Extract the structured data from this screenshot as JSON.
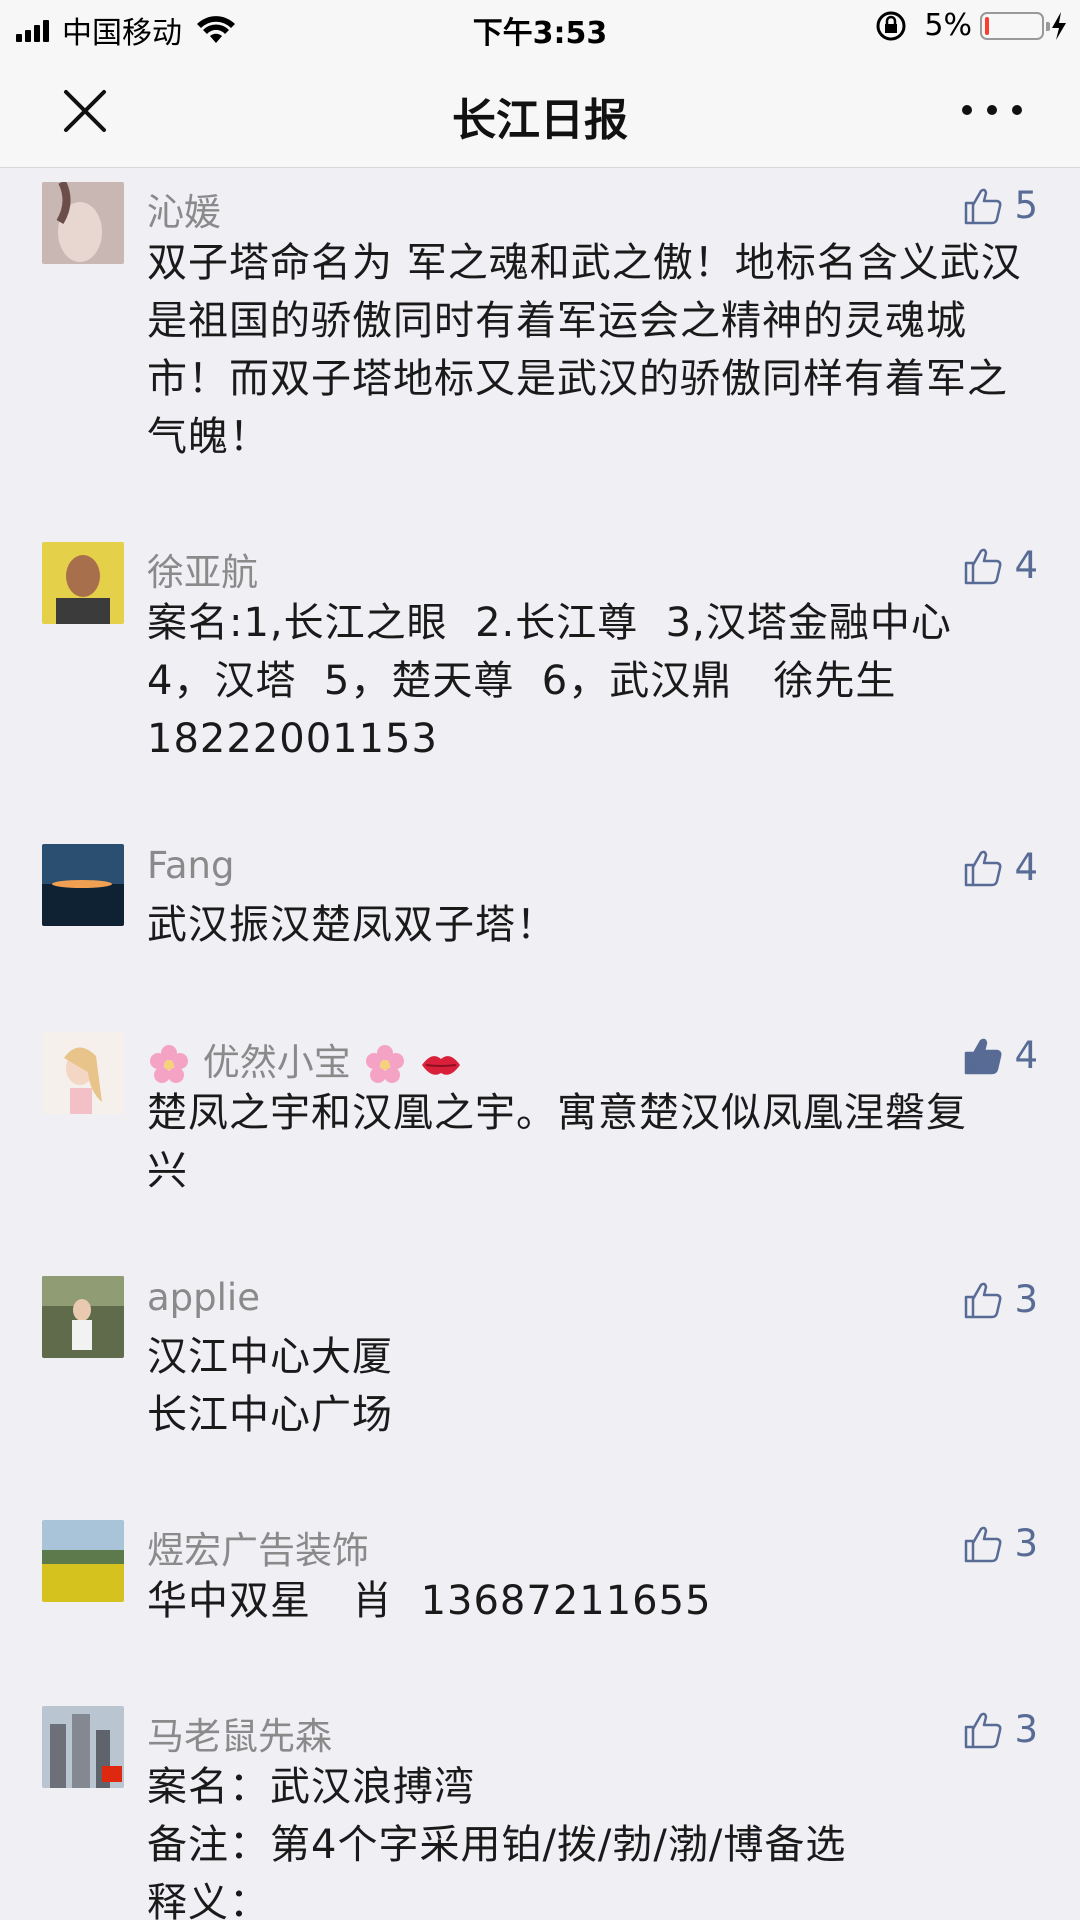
{
  "status_bar": {
    "carrier": "中国移动",
    "time": "下午3:53",
    "battery_percent": "5%"
  },
  "nav": {
    "title": "长江日报",
    "close_icon": "close-icon",
    "more_icon": "more-icon"
  },
  "comments": [
    {
      "name": "沁媛",
      "likes": "5",
      "liked": false,
      "text": "双子塔命名为 军之魂和武之傲！地标名含义武汉是祖国的骄傲同时有着军运会之精神的灵魂城市！而双子塔地标又是武汉的骄傲同样有着军之气魄！"
    },
    {
      "name": "徐亚航",
      "likes": "4",
      "liked": false,
      "text": "案名:1,长江之眼  2.长江尊  3,汉塔金融中心\n4，汉塔  5，楚天尊  6，武汉鼎   徐先生\n18222001153"
    },
    {
      "name": "Fang",
      "likes": "4",
      "liked": false,
      "text": "武汉振汉楚凤双子塔！"
    },
    {
      "name": "优然小宝",
      "likes": "4",
      "liked": true,
      "text": "楚凤之宇和汉凰之宇。寓意楚汉似凤凰涅磐复\n兴"
    },
    {
      "name": "applie",
      "likes": "3",
      "liked": false,
      "text": "汉江中心大厦\n长江中心广场"
    },
    {
      "name": "煜宏广告装饰",
      "likes": "3",
      "liked": false,
      "text": "华中双星   肖  13687211655"
    },
    {
      "name": "马老鼠先森",
      "likes": "3",
      "liked": false,
      "text": "案名：武汉浪搏湾\n备注：第4个字采用铂/拨/勃/渤/博备选\n释义："
    }
  ],
  "colors": {
    "background": "#efeff4",
    "like_accent": "#576b95",
    "name_gray": "#8a8a8a"
  }
}
